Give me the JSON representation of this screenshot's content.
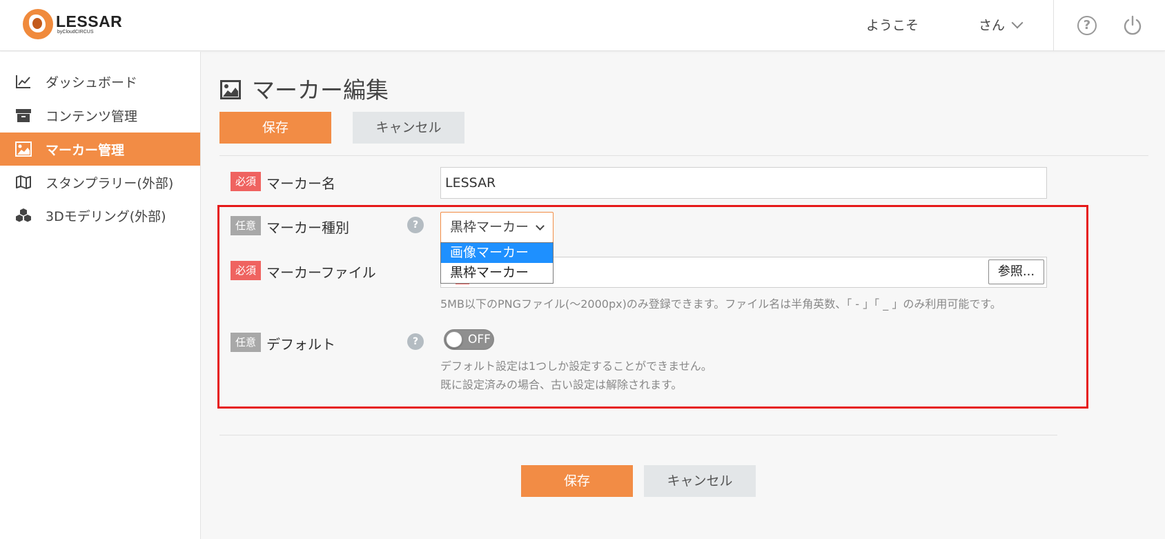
{
  "header": {
    "logo_name": "LESSAR",
    "logo_sub": "byCloudCIRCUS",
    "welcome": "ようこそ",
    "user_suffix": "さん",
    "help_icon": "question-circle-icon",
    "power_icon": "power-icon"
  },
  "sidebar": {
    "items": [
      {
        "label": "ダッシュボード",
        "icon": "chart-line-icon"
      },
      {
        "label": "コンテンツ管理",
        "icon": "archive-box-icon"
      },
      {
        "label": "マーカー管理",
        "icon": "image-icon",
        "active": true
      },
      {
        "label": "スタンプラリー(外部)",
        "icon": "map-icon"
      },
      {
        "label": "3Dモデリング(外部)",
        "icon": "cubes-icon"
      }
    ]
  },
  "page": {
    "title": "マーカー編集",
    "save_label": "保存",
    "cancel_label": "キャンセル"
  },
  "form": {
    "required_badge": "必須",
    "optional_badge": "任意",
    "help_mark": "?",
    "marker_name": {
      "label": "マーカー名",
      "value": "LESSAR"
    },
    "marker_type": {
      "label": "マーカー種別",
      "selected": "黒枠マーカー",
      "options": [
        "画像マーカー",
        "黒枠マーカー"
      ],
      "highlighted_option": "画像マーカー"
    },
    "marker_file": {
      "label": "マーカーファイル",
      "browse_label": "参照...",
      "hint": "5MB以下のPNGファイル(～2000px)のみ登録できます。ファイル名は半角英数、「 - 」「 _ 」のみ利用可能です。"
    },
    "default": {
      "label": "デフォルト",
      "toggle_state": "OFF",
      "hint_line1": "デフォルト設定は1つしか設定することができません。",
      "hint_line2": "既に設定済みの場合、古い設定は解除されます。"
    }
  },
  "colors": {
    "accent": "#f28c45",
    "required": "#ef6360",
    "optional": "#a8a8a8",
    "highlight": "#e61919",
    "dropdown_selected": "#1e90ff"
  }
}
